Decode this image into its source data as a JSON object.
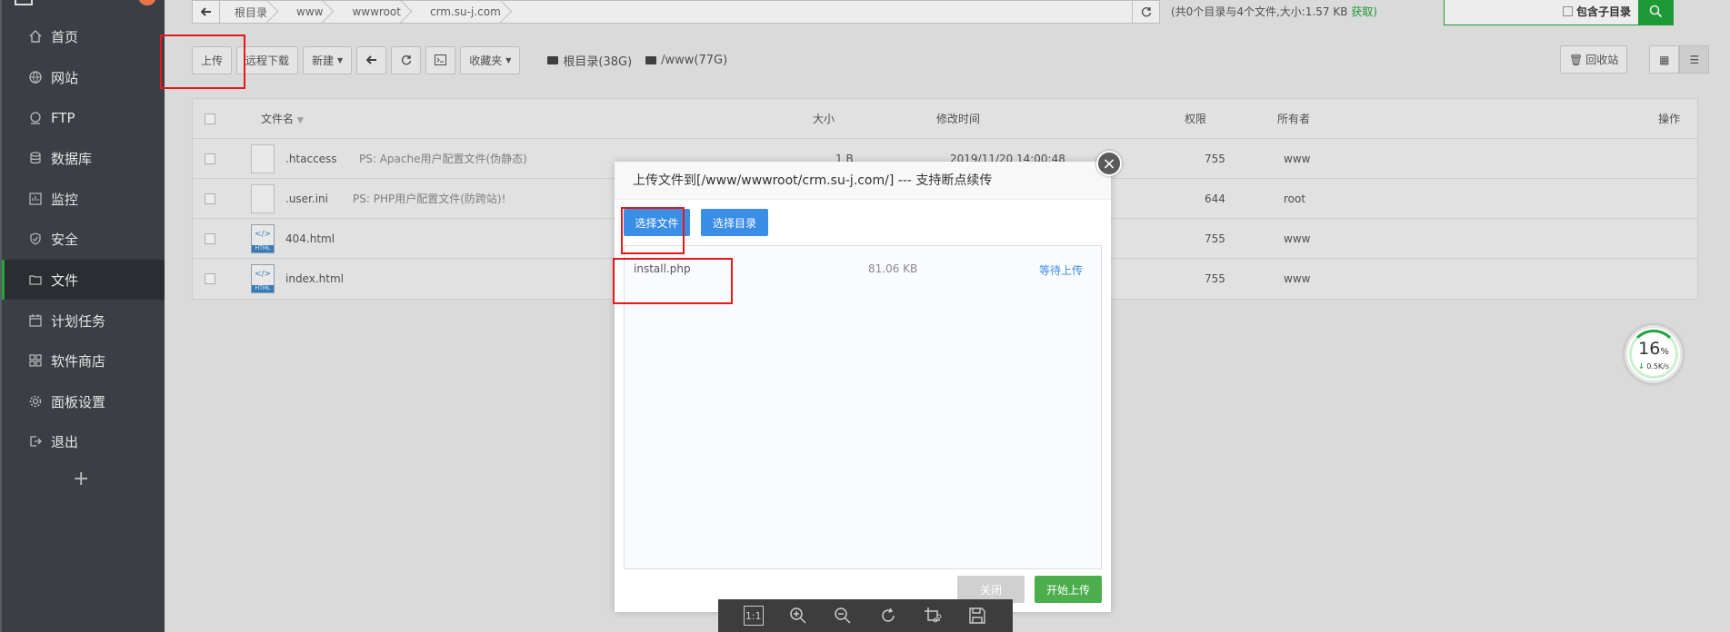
{
  "sidebar": {
    "items": [
      {
        "label": "首页",
        "icon": "home-icon"
      },
      {
        "label": "网站",
        "icon": "globe-icon"
      },
      {
        "label": "FTP",
        "icon": "ftp-icon"
      },
      {
        "label": "数据库",
        "icon": "database-icon"
      },
      {
        "label": "监控",
        "icon": "monitor-icon"
      },
      {
        "label": "安全",
        "icon": "shield-icon"
      },
      {
        "label": "文件",
        "icon": "folder-icon"
      },
      {
        "label": "计划任务",
        "icon": "calendar-icon"
      },
      {
        "label": "软件商店",
        "icon": "grid-icon"
      },
      {
        "label": "面板设置",
        "icon": "gear-icon"
      },
      {
        "label": "退出",
        "icon": "logout-icon"
      }
    ],
    "active_index": 6,
    "add_label": "+"
  },
  "breadcrumb": {
    "items": [
      "根目录",
      "www",
      "wwwroot",
      "crm.su-j.com"
    ]
  },
  "summary": {
    "text": "(共0个目录与4个文件,大小:1.57 KB",
    "action": "获取)"
  },
  "search": {
    "subdir_label": "包含子目录"
  },
  "toolbar": {
    "upload": "上传",
    "remote_download": "远程下载",
    "new": "新建",
    "favorites": "收藏夹",
    "disk_root": "根目录(38G)",
    "disk_www": "/www(77G)",
    "recycle": "回收站"
  },
  "table": {
    "headers": {
      "name": "文件名",
      "size": "大小",
      "mtime": "修改时间",
      "perm": "权限",
      "owner": "所有者",
      "actions": "操作"
    },
    "rows": [
      {
        "name": ".htaccess",
        "ps": "PS: Apache用户配置文件(伪静态)",
        "size": "1 B",
        "mtime": "2019/11/20 14:00:48",
        "perm": "755",
        "owner": "www",
        "type": "file"
      },
      {
        "name": ".user.ini",
        "ps": "PS: PHP用户配置文件(防跨站)!",
        "size": "",
        "mtime": "",
        "perm": "644",
        "owner": "root",
        "type": "file"
      },
      {
        "name": "404.html",
        "ps": "",
        "size": "",
        "mtime": "",
        "perm": "755",
        "owner": "www",
        "type": "html"
      },
      {
        "name": "index.html",
        "ps": "",
        "size": "",
        "mtime": "",
        "perm": "755",
        "owner": "www",
        "type": "html"
      }
    ]
  },
  "modal": {
    "title": "上传文件到[/www/wwwroot/crm.su-j.com/] --- 支持断点续传",
    "select_files": "选择文件",
    "select_dir": "选择目录",
    "file": {
      "name": "install.php",
      "size": "81.06 KB",
      "status": "等待上传"
    },
    "close": "关闭",
    "start": "开始上传"
  },
  "gauge": {
    "percent": "16",
    "percent_unit": "%",
    "speed": "0.5K/s"
  },
  "viewer": {
    "actual_size": "1:1"
  }
}
